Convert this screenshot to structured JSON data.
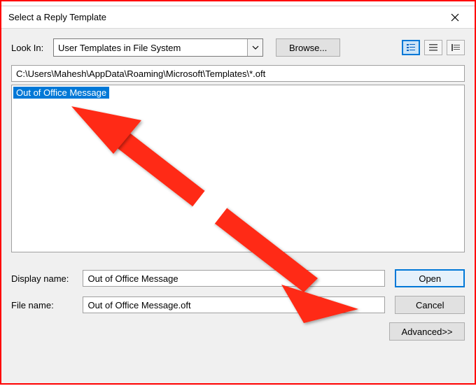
{
  "window": {
    "title": "Select a Reply Template"
  },
  "lookin": {
    "label": "Look In:",
    "value": "User Templates in File System",
    "browse_label": "Browse..."
  },
  "path": {
    "value": "C:\\Users\\Mahesh\\AppData\\Roaming\\Microsoft\\Templates\\*.oft"
  },
  "files": {
    "items": [
      {
        "name": "Out of Office Message"
      }
    ]
  },
  "form": {
    "display_name_label": "Display name:",
    "display_name_value": "Out of Office Message",
    "file_name_label": "File name:",
    "file_name_value": "Out of Office Message.oft"
  },
  "buttons": {
    "open": "Open",
    "cancel": "Cancel",
    "advanced": "Advanced>>"
  },
  "icons": {
    "view_large": "large-icons-view-icon",
    "view_list": "list-view-icon",
    "view_details": "details-view-icon"
  }
}
